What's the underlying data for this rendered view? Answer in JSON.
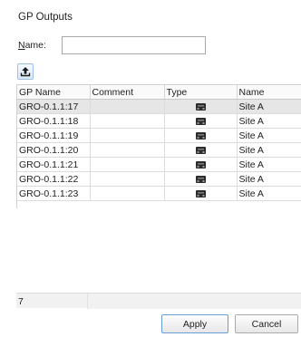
{
  "window": {
    "title": "GP Outputs"
  },
  "filter": {
    "name_label_prefix": "N",
    "name_label_rest": "ame:",
    "name_value": ""
  },
  "toolbar": {
    "export_icon": "upload-arrow-icon"
  },
  "table": {
    "columns": [
      "GP Name",
      "Comment",
      "Type",
      "Name"
    ],
    "rows": [
      {
        "gp_name": "GRO-0.1.1:17",
        "comment": "",
        "type_icon": "output-device-icon",
        "name": "Site A"
      },
      {
        "gp_name": "GRO-0.1.1:18",
        "comment": "",
        "type_icon": "output-device-icon",
        "name": "Site A"
      },
      {
        "gp_name": "GRO-0.1.1:19",
        "comment": "",
        "type_icon": "output-device-icon",
        "name": "Site A"
      },
      {
        "gp_name": "GRO-0.1.1:20",
        "comment": "",
        "type_icon": "output-device-icon",
        "name": "Site A"
      },
      {
        "gp_name": "GRO-0.1.1:21",
        "comment": "",
        "type_icon": "output-device-icon",
        "name": "Site A"
      },
      {
        "gp_name": "GRO-0.1.1:22",
        "comment": "",
        "type_icon": "output-device-icon",
        "name": "Site A"
      },
      {
        "gp_name": "GRO-0.1.1:23",
        "comment": "",
        "type_icon": "output-device-icon",
        "name": "Site A"
      }
    ]
  },
  "status": {
    "count": "7"
  },
  "buttons": {
    "apply": "Apply",
    "cancel": "Cancel"
  },
  "colors": {
    "selected_row": "#e6e6e6",
    "apply_border": "#6a9ed6",
    "status_bg": "#f1f1f1"
  }
}
